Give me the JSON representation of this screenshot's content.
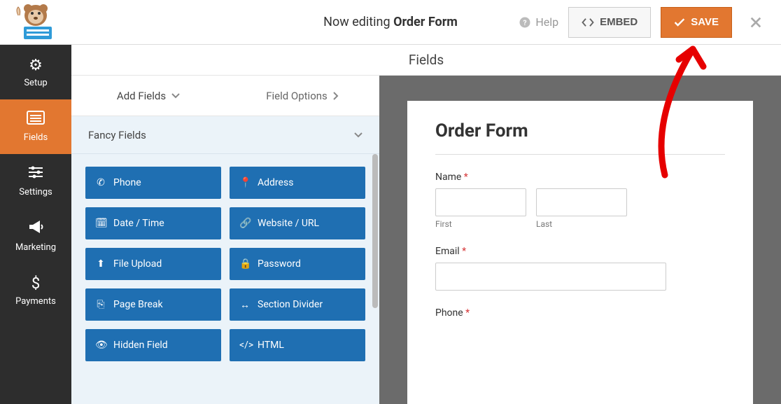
{
  "header": {
    "editing_prefix": "Now editing ",
    "form_name": "Order Form",
    "help_label": "Help",
    "embed_label": "EMBED",
    "save_label": "SAVE"
  },
  "sidebar": {
    "items": [
      {
        "label": "Setup"
      },
      {
        "label": "Fields"
      },
      {
        "label": "Settings"
      },
      {
        "label": "Marketing"
      },
      {
        "label": "Payments"
      }
    ]
  },
  "section_title": "Fields",
  "tabs": {
    "add": "Add Fields",
    "options": "Field Options"
  },
  "accordion_title": "Fancy Fields",
  "fancy_fields": [
    {
      "icon": "phone",
      "label": "Phone"
    },
    {
      "icon": "pin",
      "label": "Address"
    },
    {
      "icon": "calendar",
      "label": "Date / Time"
    },
    {
      "icon": "link",
      "label": "Website / URL"
    },
    {
      "icon": "upload",
      "label": "File Upload"
    },
    {
      "icon": "lock",
      "label": "Password"
    },
    {
      "icon": "pagebreak",
      "label": "Page Break"
    },
    {
      "icon": "divider",
      "label": "Section Divider"
    },
    {
      "icon": "hidden",
      "label": "Hidden Field"
    },
    {
      "icon": "code",
      "label": "HTML"
    }
  ],
  "preview": {
    "title": "Order Form",
    "fields": {
      "name": {
        "label": "Name",
        "required": true,
        "first": "First",
        "last": "Last"
      },
      "email": {
        "label": "Email",
        "required": true
      },
      "phone": {
        "label": "Phone",
        "required": true
      }
    }
  }
}
